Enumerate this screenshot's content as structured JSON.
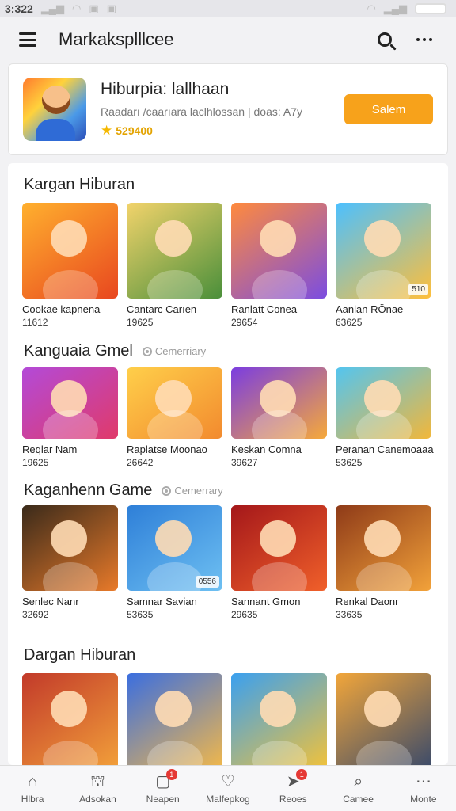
{
  "status": {
    "time": "3:322"
  },
  "header": {
    "title": "Markaksplllcee"
  },
  "featured": {
    "title": "Hiburpia: lallhaan",
    "subtitle": "Raadarı /caarıara laclhlossan | doas: A7y",
    "rating": "529400",
    "button_label": "Salem"
  },
  "sections": [
    {
      "title": "Kargan Hiburan",
      "tag": "",
      "items": [
        {
          "name": "Cookae kapnena",
          "count": "11612",
          "colors": [
            "#ffb02e",
            "#e8471f"
          ],
          "badge": ""
        },
        {
          "name": "Cantarc Carıen",
          "count": "19625",
          "colors": [
            "#f2d36b",
            "#4a8f3a"
          ],
          "badge": ""
        },
        {
          "name": "Ranlatt Conea",
          "count": "29654",
          "colors": [
            "#ff8a3d",
            "#7b4de0"
          ],
          "badge": ""
        },
        {
          "name": "Aanlan RÖnae",
          "count": "63625",
          "colors": [
            "#4cc0ff",
            "#ffbf3a"
          ],
          "badge": "510"
        }
      ]
    },
    {
      "title": "Kanguaia Gmel",
      "tag": "Cemerriary",
      "items": [
        {
          "name": "Reqlar Nam",
          "count": "19625",
          "colors": [
            "#b34ad8",
            "#e03a6a"
          ],
          "badge": ""
        },
        {
          "name": "Raplatse Moonao",
          "count": "26642",
          "colors": [
            "#ffcf4a",
            "#f28a2e"
          ],
          "badge": ""
        },
        {
          "name": "Keskan Comna",
          "count": "39627",
          "colors": [
            "#7b3de0",
            "#f6a93a"
          ],
          "badge": ""
        },
        {
          "name": "Peranan Canemoaaa",
          "count": "53625",
          "colors": [
            "#53c5f0",
            "#f2b73a"
          ],
          "badge": ""
        }
      ]
    },
    {
      "title": "Kaganhenn Game",
      "tag": "Cemerrary",
      "items": [
        {
          "name": "Senlec Nanr",
          "count": "32692",
          "colors": [
            "#3a2a1a",
            "#e87a2a"
          ],
          "badge": ""
        },
        {
          "name": "Samnar Savian",
          "count": "53635",
          "colors": [
            "#2e7fd8",
            "#6ec0f2"
          ],
          "badge": "0556"
        },
        {
          "name": "Sannant Gmon",
          "count": "29635",
          "colors": [
            "#a4171a",
            "#f0602a"
          ],
          "badge": ""
        },
        {
          "name": "Renkal Daonr",
          "count": "33635",
          "colors": [
            "#8e3a18",
            "#f2a23a"
          ],
          "badge": ""
        }
      ]
    },
    {
      "title": "Dargan Hiburan",
      "tag": "",
      "items": [
        {
          "name": "",
          "count": "",
          "colors": [
            "#c23a2a",
            "#f2a03a"
          ],
          "badge": ""
        },
        {
          "name": "",
          "count": "",
          "colors": [
            "#3a6ee0",
            "#f2b84a"
          ],
          "badge": ""
        },
        {
          "name": "",
          "count": "",
          "colors": [
            "#3aa0f0",
            "#f2c23a"
          ],
          "badge": ""
        },
        {
          "name": "",
          "count": "",
          "colors": [
            "#f2a63a",
            "#3a4a6a"
          ],
          "badge": ""
        }
      ]
    }
  ],
  "bottom_nav": [
    {
      "label": "Hlbra",
      "icon": "home-icon",
      "badge": ""
    },
    {
      "label": "Adsokan",
      "icon": "store-icon",
      "badge": ""
    },
    {
      "label": "Neapen",
      "icon": "inbox-icon",
      "badge": "1"
    },
    {
      "label": "Malfepkog",
      "icon": "heart-icon",
      "badge": ""
    },
    {
      "label": "Reoes",
      "icon": "send-icon",
      "badge": "1"
    },
    {
      "label": "Camee",
      "icon": "search-icon",
      "badge": ""
    },
    {
      "label": "Monte",
      "icon": "more-icon",
      "badge": ""
    }
  ]
}
